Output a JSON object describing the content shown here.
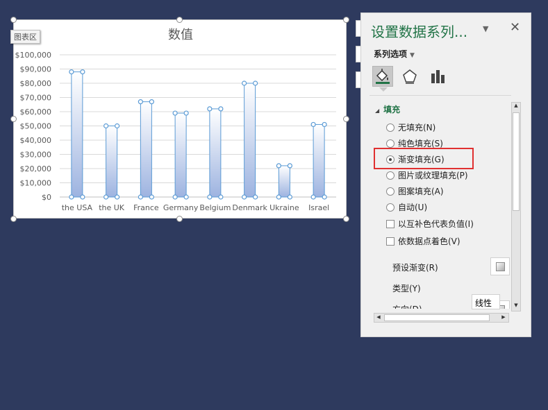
{
  "chart": {
    "area_label": "图表区"
  },
  "chart_data": {
    "type": "bar",
    "title": "数值",
    "categories": [
      "the USA",
      "the UK",
      "France",
      "Germany",
      "Belgium",
      "Denmark",
      "Ukraine",
      "Israel"
    ],
    "values": [
      88000,
      50000,
      67000,
      59000,
      62000,
      80000,
      22000,
      51000
    ],
    "ylim": [
      0,
      100000
    ],
    "yticks": [
      0,
      10000,
      20000,
      30000,
      40000,
      50000,
      60000,
      70000,
      80000,
      90000,
      100000
    ],
    "ytick_labels": [
      "$0",
      "$10,000",
      "$20,000",
      "$30,000",
      "$40,000",
      "$50,000",
      "$60,000",
      "$70,000",
      "$80,000",
      "$90,000",
      "$100,000"
    ],
    "grid": true,
    "bar_gradient": [
      "#ffffff",
      "#9db3e0"
    ],
    "bar_border": "#5b9bd5"
  },
  "pane": {
    "title": "设置数据系列...",
    "series_options": "系列选项",
    "section_fill": "填充",
    "fill_options": [
      {
        "label": "无填充(N)",
        "selected": false
      },
      {
        "label": "纯色填充(S)",
        "selected": false
      },
      {
        "label": "渐变填充(G)",
        "selected": true
      },
      {
        "label": "图片或纹理填充(P)",
        "selected": false
      },
      {
        "label": "图案填充(A)",
        "selected": false
      },
      {
        "label": "自动(U)",
        "selected": false
      }
    ],
    "checkboxes": [
      {
        "label": "以互补色代表负值(I)"
      },
      {
        "label": "依数据点着色(V)"
      }
    ],
    "preset_gradient_label": "预设渐变(R)",
    "type_label": "类型(Y)",
    "type_value": "线性",
    "direction_label": "方向(D)"
  },
  "colors": {
    "background": "#2e3a5e",
    "accent": "#217346",
    "highlight": "#e03030"
  }
}
